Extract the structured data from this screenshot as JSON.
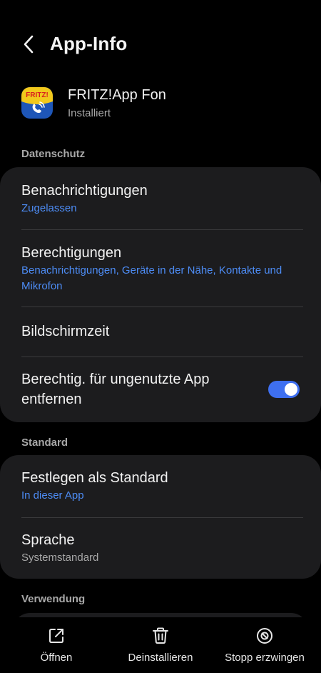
{
  "header": {
    "title": "App-Info",
    "back_icon": "chevron-left-icon"
  },
  "app": {
    "name": "FRITZ!App Fon",
    "status": "Installiert",
    "icon_text": "FRITZ!",
    "icon_name": "fritz-app-fon-icon"
  },
  "sections": {
    "datenschutz": {
      "label": "Datenschutz",
      "items": [
        {
          "title": "Benachrichtigungen",
          "subtitle": "Zugelassen"
        },
        {
          "title": "Berechtigungen",
          "subtitle": "Benachrichtigungen, Geräte in der Nähe, Kontakte und Mikrofon"
        },
        {
          "title": "Bildschirmzeit"
        },
        {
          "title": "Berechtig. für ungenutzte App entfernen",
          "toggle_on": true
        }
      ]
    },
    "standard": {
      "label": "Standard",
      "items": [
        {
          "title": "Festlegen als Standard",
          "subtitle": "In dieser App"
        },
        {
          "title": "Sprache",
          "subtitle": "Systemstandard"
        }
      ]
    },
    "verwendung": {
      "label": "Verwendung"
    }
  },
  "bottom_bar": {
    "open": {
      "label": "Öffnen",
      "icon": "open-external-icon"
    },
    "uninstall": {
      "label": "Deinstallieren",
      "icon": "trash-icon"
    },
    "force_stop": {
      "label": "Stopp erzwingen",
      "icon": "stop-icon"
    }
  },
  "colors": {
    "background": "#000000",
    "card": "#1c1c1e",
    "accent": "#4d8cf5",
    "toggle": "#3e6ff0",
    "secondary_text": "#a8a8a8"
  }
}
